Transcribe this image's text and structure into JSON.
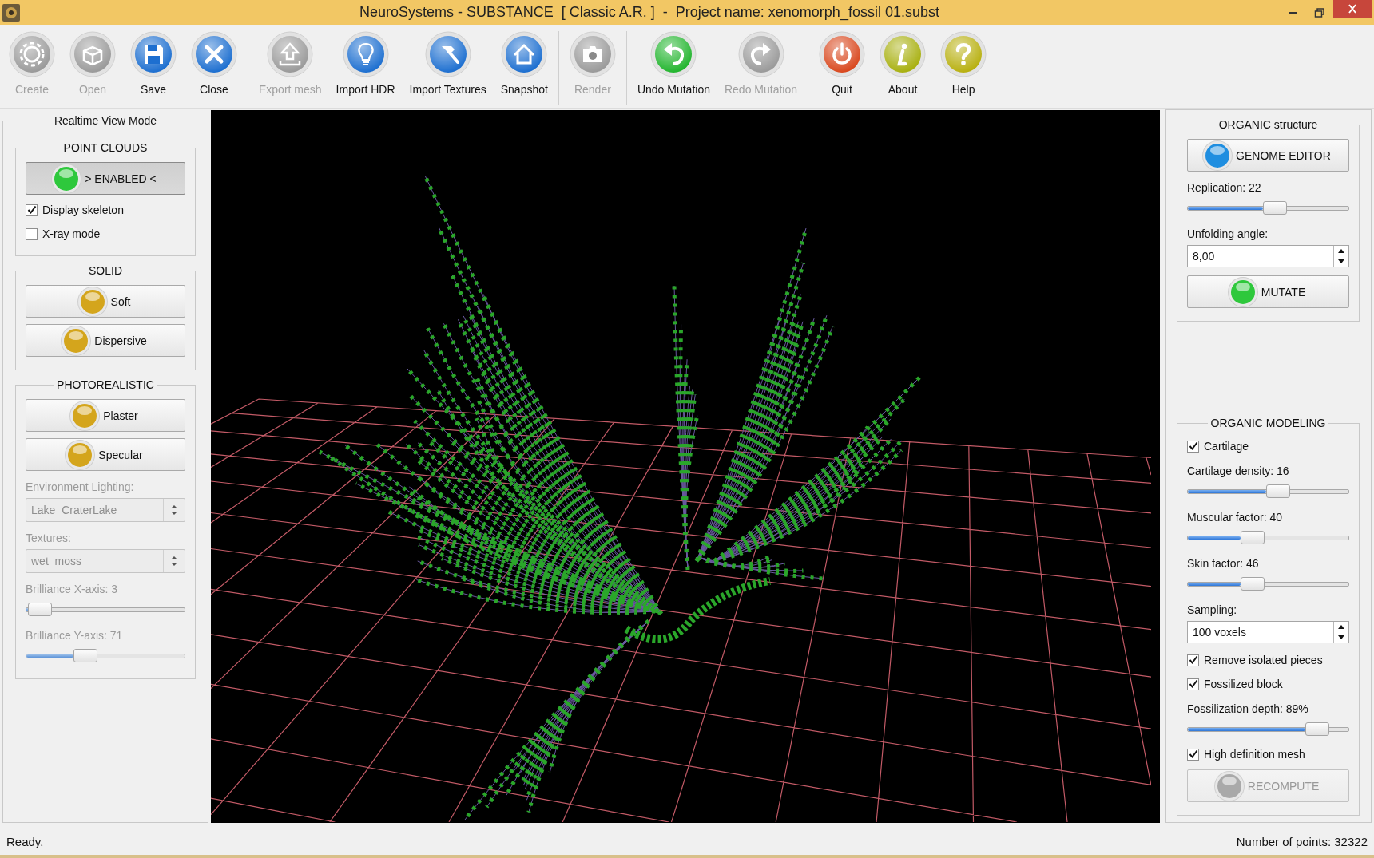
{
  "window": {
    "title": "NeuroSystems - SUBSTANCE  [ Classic A.R. ]  -  Project name: xenomorph_fossil 01.subst"
  },
  "toolbar": {
    "groups": [
      {
        "buttons": [
          {
            "label": "Create",
            "disabled": true
          },
          {
            "label": "Open",
            "disabled": true
          },
          {
            "label": "Save",
            "disabled": false
          },
          {
            "label": "Close",
            "disabled": false
          }
        ]
      },
      {
        "buttons": [
          {
            "label": "Export mesh",
            "disabled": true
          },
          {
            "label": "Import HDR",
            "disabled": false
          },
          {
            "label": "Import Textures",
            "disabled": false
          },
          {
            "label": "Snapshot",
            "disabled": false
          }
        ]
      },
      {
        "buttons": [
          {
            "label": "Render",
            "disabled": true
          }
        ]
      },
      {
        "buttons": [
          {
            "label": "Undo Mutation",
            "disabled": false
          },
          {
            "label": "Redo Mutation",
            "disabled": true
          }
        ]
      },
      {
        "buttons": [
          {
            "label": "Quit",
            "disabled": false
          },
          {
            "label": "About",
            "disabled": false
          },
          {
            "label": "Help",
            "disabled": false
          }
        ]
      }
    ]
  },
  "left_panel": {
    "title": "Realtime View Mode",
    "groups": [
      {
        "title": "POINT CLOUDS",
        "items": [
          {
            "kind": "lamp_button",
            "label": "> ENABLED <",
            "color": "#2ec83c",
            "selected": true,
            "disabled": false
          },
          {
            "kind": "checkbox",
            "label": "Display skeleton",
            "checked": true,
            "disabled": false
          },
          {
            "kind": "checkbox",
            "label": "X-ray mode",
            "checked": false,
            "disabled": false
          }
        ]
      },
      {
        "title": "SOLID",
        "items": [
          {
            "kind": "lamp_button",
            "label": "Soft",
            "color": "#d4a51c",
            "selected": false,
            "disabled": false
          },
          {
            "kind": "lamp_button",
            "label": "Dispersive",
            "color": "#d4a51c",
            "selected": false,
            "disabled": false
          }
        ]
      },
      {
        "title": "PHOTOREALISTIC",
        "items": [
          {
            "kind": "lamp_button",
            "label": "Plaster",
            "color": "#d4a51c",
            "selected": false,
            "disabled": false
          },
          {
            "kind": "lamp_button",
            "label": "Specular",
            "color": "#d4a51c",
            "selected": false,
            "disabled": false
          },
          {
            "kind": "combo",
            "label": "Environment Lighting:",
            "value": "Lake_CraterLake",
            "disabled": true
          },
          {
            "kind": "combo",
            "label": "Textures:",
            "value": "wet_moss",
            "disabled": true
          },
          {
            "kind": "slider",
            "label": "Brilliance X-axis: 3",
            "level": 0.01,
            "disabled": true
          },
          {
            "kind": "slider",
            "label": "Brilliance Y-axis: 71",
            "level": 0.3,
            "disabled": true
          }
        ]
      }
    ]
  },
  "right_panel": {
    "groups": [
      {
        "title": "ORGANIC structure",
        "items": [
          {
            "kind": "lamp_button",
            "label": "GENOME EDITOR",
            "color": "#1f8ee0",
            "selected": false,
            "disabled": false
          },
          {
            "kind": "slider",
            "label": "Replication: 22",
            "level": 0.47,
            "disabled": false
          },
          {
            "kind": "spinbox",
            "label": "Unfolding angle:",
            "value": "8,00",
            "disabled": false
          },
          {
            "kind": "lamp_button",
            "label": "MUTATE",
            "color": "#2ec83c",
            "selected": false,
            "disabled": false
          }
        ]
      },
      {
        "title": "ORGANIC MODELING",
        "items": [
          {
            "kind": "checkbox",
            "label": "Cartilage",
            "checked": true,
            "disabled": false
          },
          {
            "kind": "slider",
            "label": "Cartilage density: 16",
            "level": 0.49,
            "disabled": false
          },
          {
            "kind": "slider",
            "label": "Muscular factor: 40",
            "level": 0.33,
            "disabled": false
          },
          {
            "kind": "slider",
            "label": "Skin factor: 46",
            "level": 0.33,
            "disabled": false
          },
          {
            "kind": "spinbox",
            "label": "Sampling:",
            "value": "100 voxels",
            "disabled": false
          },
          {
            "kind": "checkbox",
            "label": "Remove isolated pieces",
            "checked": true,
            "disabled": false
          },
          {
            "kind": "checkbox",
            "label": "Fossilized block",
            "checked": true,
            "disabled": false
          },
          {
            "kind": "slider",
            "label": "Fossilization depth: 89%",
            "level": 0.73,
            "disabled": false
          },
          {
            "kind": "checkbox",
            "label": "High definition mesh",
            "checked": true,
            "disabled": false
          },
          {
            "kind": "lamp_button",
            "label": "RECOMPUTE",
            "color": "#a9a9a9",
            "selected": false,
            "disabled": true
          }
        ]
      }
    ]
  },
  "status_bar": {
    "message": "Ready.",
    "points": "Number of points: 32322"
  }
}
